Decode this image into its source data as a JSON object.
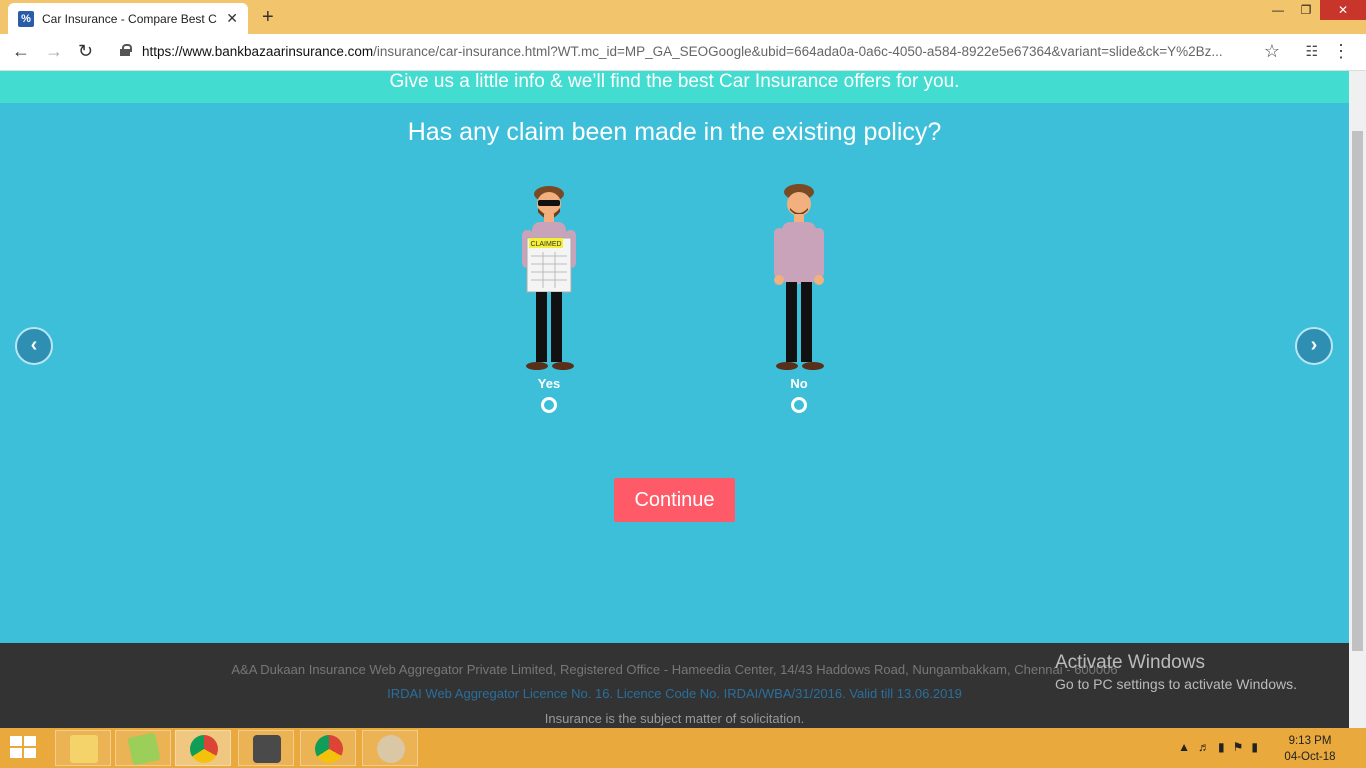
{
  "browser": {
    "tab_title": "Car Insurance - Compare Best Ca",
    "tab_close": "✕",
    "new_tab": "+",
    "url_host": "https://www.bankbazaarinsurance.com",
    "url_path": "/insurance/car-insurance.html?WT.mc_id=MP_GA_SEOGoogle&ubid=664ada0a-0a6c-4050-a584-8922e5e67364&variant=slide&ck=Y%2Bz..."
  },
  "page": {
    "banner": "Give us a little info & we’ll find the best Car Insurance offers for you.",
    "question": "Has any claim been made in the existing policy?",
    "options": [
      {
        "label": "Yes",
        "sign": "CLAIMED"
      },
      {
        "label": "No"
      }
    ],
    "continue_label": "Continue"
  },
  "footer": {
    "line1": "A&A Dukaan Insurance Web Aggregator Private Limited, Registered Office - Hameedia Center, 14/43 Haddows Road, Nungambakkam, Chennai - 600006",
    "line2": "IRDAI Web Aggregator Licence No. 16. Licence Code No. IRDAI/WBA/31/2016. Valid till 13.06.2019",
    "line3": "Insurance is the subject matter of solicitation."
  },
  "watermark": {
    "title": "Activate Windows",
    "subtitle": "Go to PC settings to activate Windows."
  },
  "taskbar": {
    "time": "9:13 PM",
    "date": "04-Oct-18"
  },
  "colors": {
    "page_bg": "#3dbfda",
    "banner_bg": "#42dcd0",
    "continue_bg": "#ff5a68",
    "footer_bg": "#333333",
    "taskbar_bg": "#e9a93c"
  }
}
